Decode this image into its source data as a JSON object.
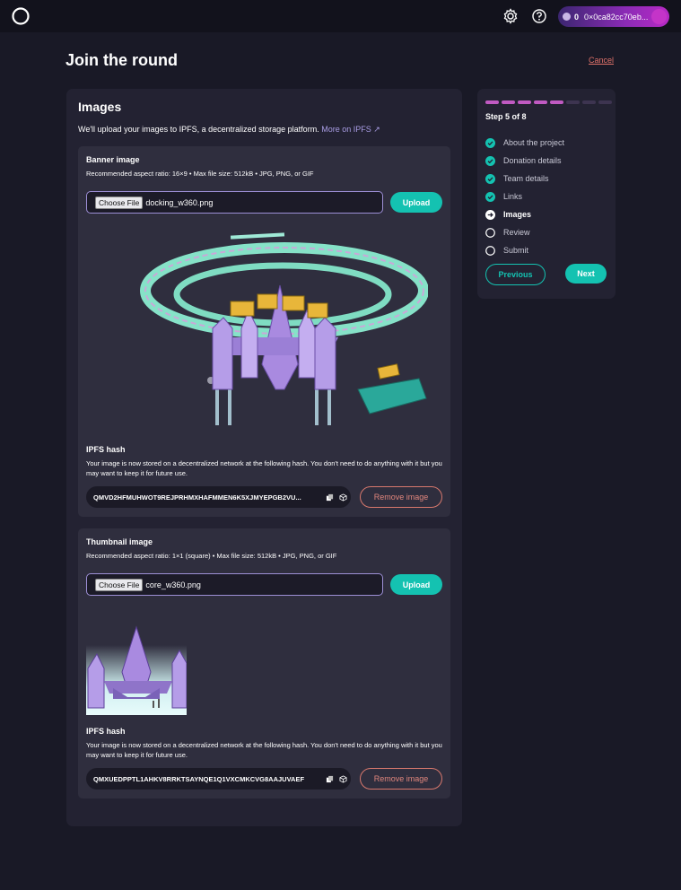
{
  "header": {
    "wallet_balance": "0",
    "wallet_address": "0×0ca82cc70eb..."
  },
  "page": {
    "title": "Join the round",
    "cancel_label": "Cancel"
  },
  "images_section": {
    "title": "Images",
    "description": "We'll upload your images to IPFS, a decentralized storage platform.",
    "more_link": "More on IPFS ↗",
    "banner": {
      "title": "Banner image",
      "hint": "Recommended aspect ratio: 16×9 • Max file size: 512kB • JPG, PNG, or GIF",
      "choose_file_label": "Choose File",
      "file_name": "docking_w360.png",
      "upload_label": "Upload",
      "ipfs_label": "IPFS hash",
      "ipfs_desc": "Your image is now stored on a decentralized network at the following hash. You don't need to do anything with it but you may want to keep it for future use.",
      "hash": "QMVD2HFMUHWOT9REJPRHMXHAFMMEN6K5XJMYEPGB2VU...",
      "remove_label": "Remove image"
    },
    "thumbnail": {
      "title": "Thumbnail image",
      "hint": "Recommended aspect ratio: 1×1 (square) • Max file size: 512kB • JPG, PNG, or GIF",
      "choose_file_label": "Choose File",
      "file_name": "core_w360.png",
      "upload_label": "Upload",
      "ipfs_label": "IPFS hash",
      "ipfs_desc": "Your image is now stored on a decentralized network at the following hash. You don't need to do anything with it but you may want to keep it for future use.",
      "hash": "QMXUEDPPTL1AHKV8RRKTSAYNQE1Q1VXCMKCVG8AAJUVAEF",
      "remove_label": "Remove image"
    }
  },
  "stepper": {
    "step_label": "Step 5 of 8",
    "current_step": 5,
    "total_steps": 8,
    "steps": [
      {
        "label": "About the project",
        "state": "done"
      },
      {
        "label": "Donation details",
        "state": "done"
      },
      {
        "label": "Team details",
        "state": "done"
      },
      {
        "label": "Links",
        "state": "done"
      },
      {
        "label": "Images",
        "state": "current"
      },
      {
        "label": "Review",
        "state": "todo"
      },
      {
        "label": "Submit",
        "state": "todo"
      }
    ],
    "previous_label": "Previous",
    "next_label": "Next"
  },
  "colors": {
    "accent": "#14c2b1",
    "progress_done": "#c05ac2",
    "progress_todo": "#3d3450",
    "danger": "#e0867d",
    "link": "#a99de4"
  }
}
